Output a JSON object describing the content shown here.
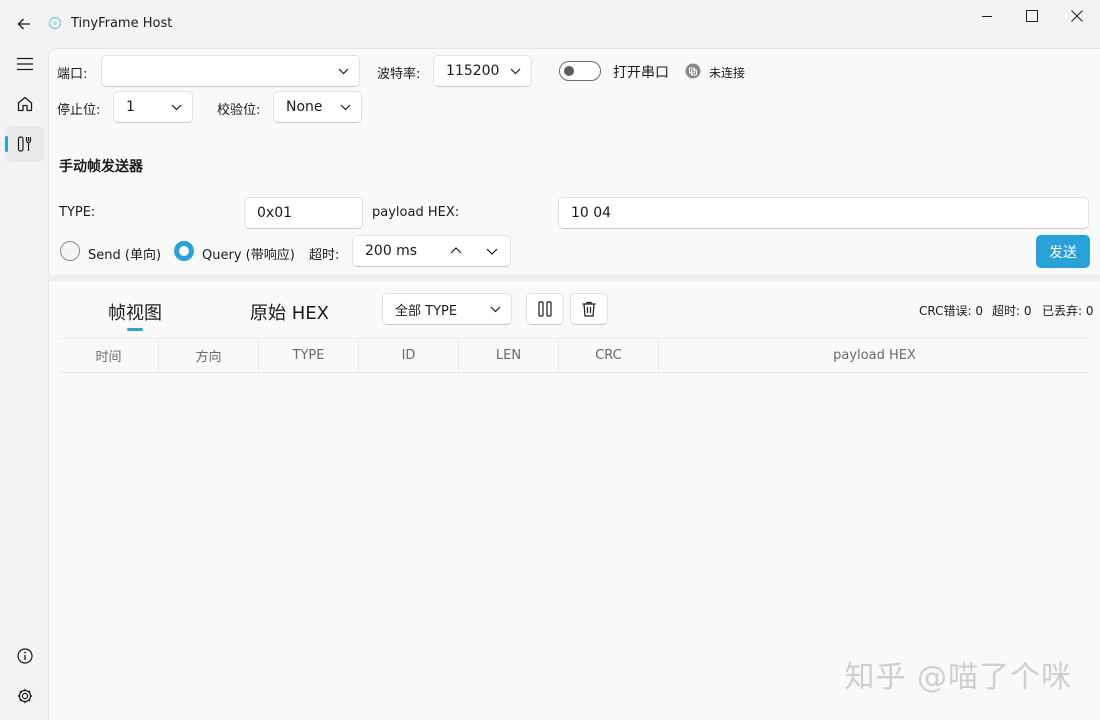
{
  "window": {
    "title": "TinyFrame Host"
  },
  "serial": {
    "port_label": "端口:",
    "port_value": "",
    "baud_label": "波特率:",
    "baud_value": "115200",
    "toggle_label": "打开串口",
    "toggle_on": false,
    "status_text": "未连接",
    "stopbits_label": "停止位:",
    "stopbits_value": "1",
    "parity_label": "校验位:",
    "parity_value": "None"
  },
  "sender": {
    "title": "手动帧发送器",
    "type_label": "TYPE:",
    "type_value": "0x01",
    "payload_label": "payload HEX:",
    "payload_value": "10 04",
    "mode_send_label": "Send (单向)",
    "mode_query_label": "Query (带响应)",
    "selected_mode": "Query",
    "timeout_label": "超时:",
    "timeout_value": "200 ms",
    "send_button": "发送"
  },
  "viewer": {
    "tabs": [
      {
        "label": "帧视图",
        "active": true
      },
      {
        "label": "原始 HEX",
        "active": false
      }
    ],
    "type_filter": "全部 TYPE",
    "stats": {
      "crc_errors": "CRC错误: 0",
      "timeouts": "超时: 0",
      "dropped": "已丢弃: 0"
    },
    "columns": [
      "时间",
      "方向",
      "TYPE",
      "ID",
      "LEN",
      "CRC",
      "payload HEX"
    ],
    "rows": []
  },
  "watermark": "知乎 @喵了个咪",
  "colors": {
    "accent": "#2aa1d8",
    "background": "#f3f3f3",
    "content": "#f9f9f9"
  },
  "icons": {
    "title_bar": [
      "back-arrow-icon",
      "app-logo-icon",
      "minimize-icon",
      "maximize-icon",
      "close-icon"
    ],
    "nav": [
      "hamburger-menu-icon",
      "home-icon",
      "tools-icon",
      "info-icon",
      "settings-gear-icon"
    ]
  }
}
